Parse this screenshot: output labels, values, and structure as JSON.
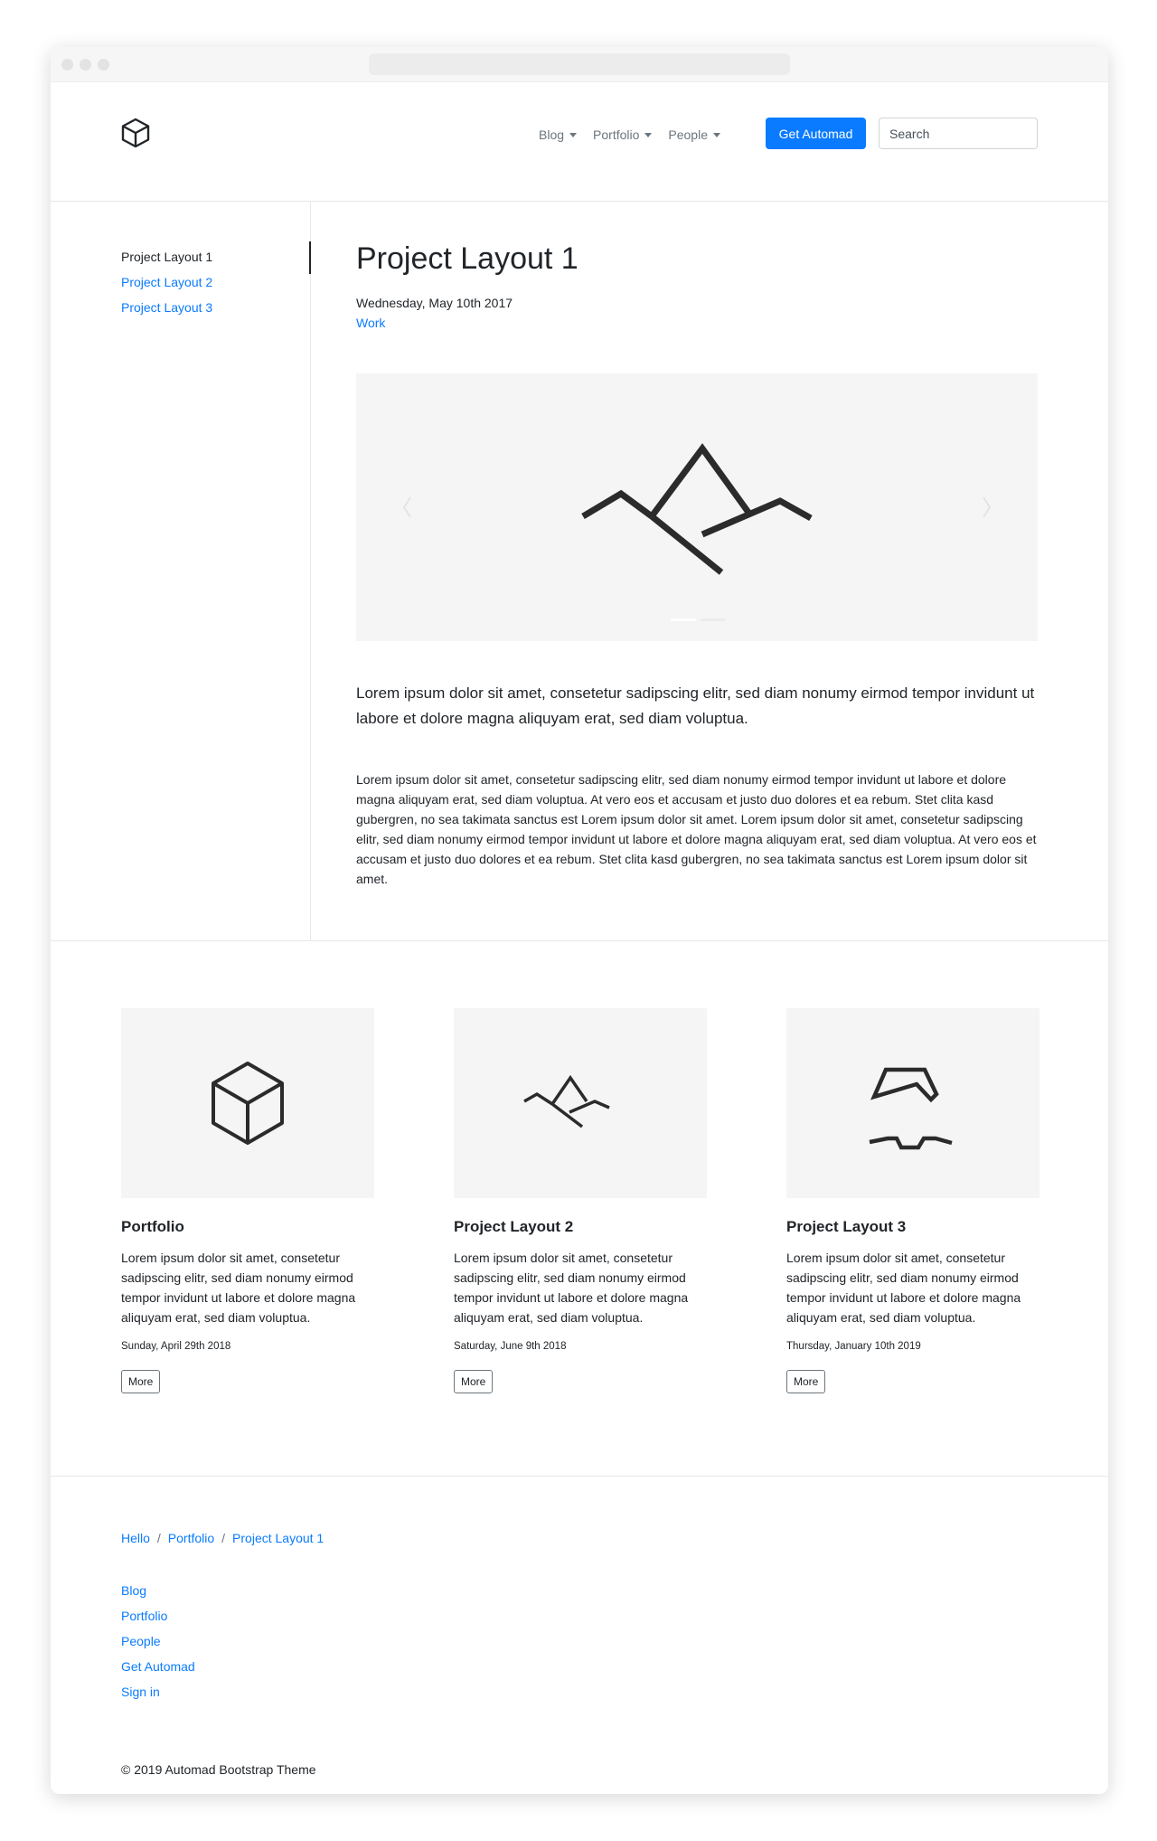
{
  "navbar": {
    "brand_icon": "cube-logo-icon",
    "links": [
      {
        "label": "Blog"
      },
      {
        "label": "Portfolio"
      },
      {
        "label": "People"
      }
    ],
    "cta_label": "Get Automad",
    "search_placeholder": "Search",
    "accent_color": "#0a7bff"
  },
  "sidebar": {
    "items": [
      {
        "label": "Project Layout 1",
        "active": true
      },
      {
        "label": "Project Layout 2",
        "active": false
      },
      {
        "label": "Project Layout 3",
        "active": false
      }
    ]
  },
  "page": {
    "title": "Project Layout 1",
    "date": "Wednesday, May 10th 2017",
    "category": "Work",
    "carousel_icon": "mountain-icon",
    "lead": "Lorem ipsum dolor sit amet, consetetur sadipscing elitr, sed diam nonumy eirmod tempor invidunt ut labore et dolore magna aliquyam erat, sed diam voluptua.",
    "body": "Lorem ipsum dolor sit amet, consetetur sadipscing elitr, sed diam nonumy eirmod tempor invidunt ut labore et dolore magna aliquyam erat, sed diam voluptua. At vero eos et accusam et justo duo dolores et ea rebum. Stet clita kasd gubergren, no sea takimata sanctus est Lorem ipsum dolor sit amet. Lorem ipsum dolor sit amet, consetetur sadipscing elitr, sed diam nonumy eirmod tempor invidunt ut labore et dolore magna aliquyam erat, sed diam voluptua. At vero eos et accusam et justo duo dolores et ea rebum. Stet clita kasd gubergren, no sea takimata sanctus est Lorem ipsum dolor sit amet."
  },
  "cards": [
    {
      "icon": "cube-icon",
      "title": "Portfolio",
      "text": "Lorem ipsum dolor sit amet, consetetur sadipscing elitr, sed diam nonumy eirmod tempor invidunt ut labore et dolore magna aliquyam erat, sed diam voluptua.",
      "date": "Sunday, April 29th 2018",
      "button": "More"
    },
    {
      "icon": "mountain-icon",
      "title": "Project Layout 2",
      "text": "Lorem ipsum dolor sit amet, consetetur sadipscing elitr, sed diam nonumy eirmod tempor invidunt ut labore et dolore magna aliquyam erat, sed diam voluptua.",
      "date": "Saturday, June 9th 2018",
      "button": "More"
    },
    {
      "icon": "broken-shape-icon",
      "title": "Project Layout 3",
      "text": "Lorem ipsum dolor sit amet, consetetur sadipscing elitr, sed diam nonumy eirmod tempor invidunt ut labore et dolore magna aliquyam erat, sed diam voluptua.",
      "date": "Thursday, January 10th 2019",
      "button": "More"
    }
  ],
  "footer": {
    "breadcrumb": [
      "Hello",
      "Portfolio",
      "Project Layout 1"
    ],
    "breadcrumb_separator": "/",
    "links": [
      "Blog",
      "Portfolio",
      "People",
      "Get Automad",
      "Sign in"
    ],
    "copyright": "© 2019 Automad Bootstrap Theme"
  }
}
